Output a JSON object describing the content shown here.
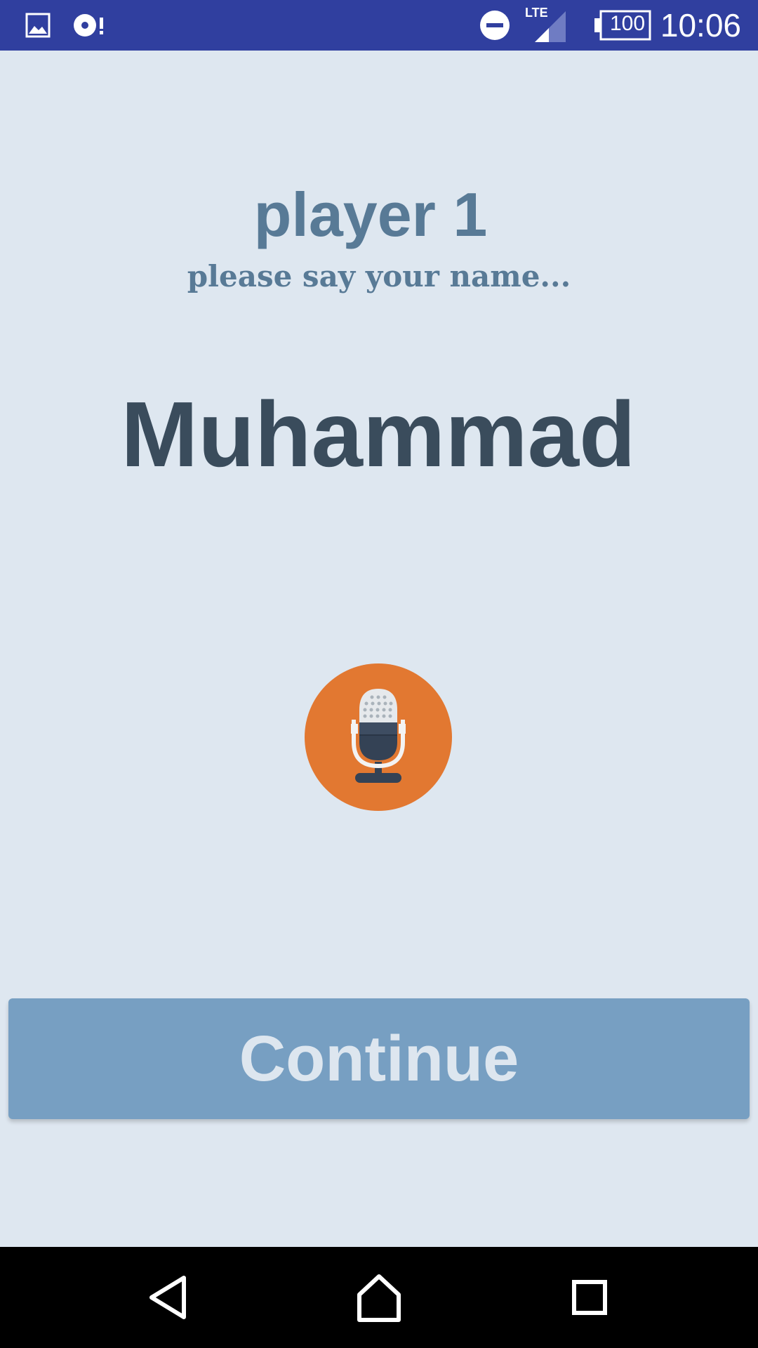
{
  "status_bar": {
    "time": "10:06",
    "battery": "100",
    "network": "LTE",
    "icons": [
      "image-icon",
      "sync-alert-icon",
      "do-not-disturb-icon",
      "signal-icon",
      "battery-icon"
    ],
    "background_color": "#303f9f"
  },
  "screen": {
    "title": "player 1",
    "subtitle": "please say your name...",
    "recognized_name": "Muhammad",
    "mic_icon": "microphone-icon",
    "mic_color": "#e27831",
    "continue_label": "Continue",
    "continue_color": "#779fc2"
  },
  "nav_bar": {
    "icons": [
      "back-icon",
      "home-icon",
      "recents-icon"
    ]
  }
}
